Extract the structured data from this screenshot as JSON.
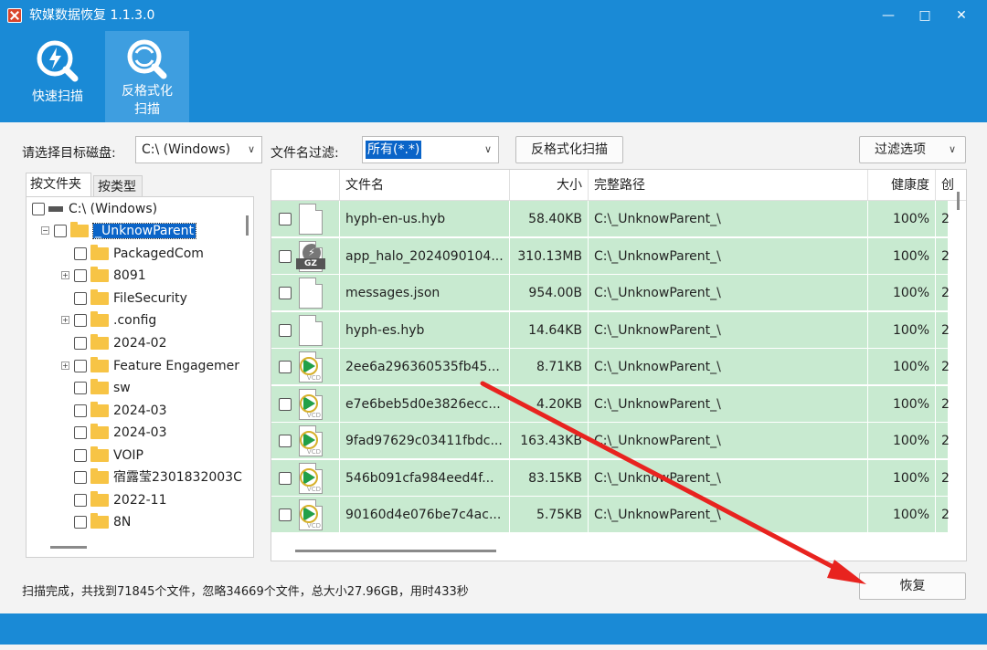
{
  "window": {
    "title": "软媒数据恢复 1.1.3.0",
    "min": "—",
    "max": "□",
    "close": "✕"
  },
  "ribbon": {
    "quick_scan": "快速扫描",
    "deformat_line1": "反格式化",
    "deformat_line2": "扫描"
  },
  "toolbar": {
    "disk_label": "请选择目标磁盘:",
    "disk_value": "C:\\ (Windows)",
    "filter_label": "文件名过滤:",
    "filter_value": "所有(*.*)",
    "deformat_scan": "反格式化扫描",
    "filter_options": "过滤选项",
    "dropdown": "∨"
  },
  "tabs": {
    "by_folder": "按文件夹",
    "by_type": "按类型"
  },
  "tree": {
    "root": "C:\\ (Windows)",
    "selected": "_UnknowParent",
    "items": [
      "PackagedCom",
      "8091",
      "FileSecurity",
      ".config",
      "2024-02",
      "Feature Engagemer",
      "sw",
      "2024-03",
      "2024-03",
      "VOIP",
      "宿露莹2301832003C",
      "2022-11",
      "8N"
    ]
  },
  "grid": {
    "headers": {
      "name": "文件名",
      "size": "大小",
      "path": "完整路径",
      "health": "健康度",
      "extra": "创"
    },
    "rows": [
      {
        "icon": "blank-file-icon",
        "name": "hyph-en-us.hyb",
        "size": "58.40KB",
        "path": "C:\\_UnknowParent_\\",
        "health": "100%",
        "extra": "2"
      },
      {
        "icon": "gz-file-icon",
        "name": "app_halo_2024090104...",
        "size": "310.13MB",
        "path": "C:\\_UnknowParent_\\",
        "health": "100%",
        "extra": "2"
      },
      {
        "icon": "blank-file-icon",
        "name": "messages.json",
        "size": "954.00B",
        "path": "C:\\_UnknowParent_\\",
        "health": "100%",
        "extra": "2"
      },
      {
        "icon": "blank-file-icon",
        "name": "hyph-es.hyb",
        "size": "14.64KB",
        "path": "C:\\_UnknowParent_\\",
        "health": "100%",
        "extra": "2"
      },
      {
        "icon": "video-file-icon",
        "name": "2ee6a296360535fb45...",
        "size": "8.71KB",
        "path": "C:\\_UnknowParent_\\",
        "health": "100%",
        "extra": "2"
      },
      {
        "icon": "video-file-icon",
        "name": "e7e6beb5d0e3826ecc...",
        "size": "4.20KB",
        "path": "C:\\_UnknowParent_\\",
        "health": "100%",
        "extra": "2"
      },
      {
        "icon": "video-file-icon",
        "name": "9fad97629c03411fbdc...",
        "size": "163.43KB",
        "path": "C:\\_UnknowParent_\\",
        "health": "100%",
        "extra": "2"
      },
      {
        "icon": "video-file-icon",
        "name": "546b091cfa984eed4f...",
        "size": "83.15KB",
        "path": "C:\\_UnknowParent_\\",
        "health": "100%",
        "extra": "2"
      },
      {
        "icon": "video-file-icon",
        "name": "90160d4e076be7c4ac...",
        "size": "5.75KB",
        "path": "C:\\_UnknowParent_\\",
        "health": "100%",
        "extra": "2"
      }
    ],
    "gz_label": "GZ",
    "vcd_label": "VCD"
  },
  "status": "扫描完成，共找到71845个文件，忽略34669个文件，总大小27.96GB，用时433秒",
  "restore": "恢复",
  "colors": {
    "accent": "#1a8ad6",
    "row_bg": "#c8ead0",
    "selection": "#0a64c8",
    "arrow": "#e8231f"
  }
}
